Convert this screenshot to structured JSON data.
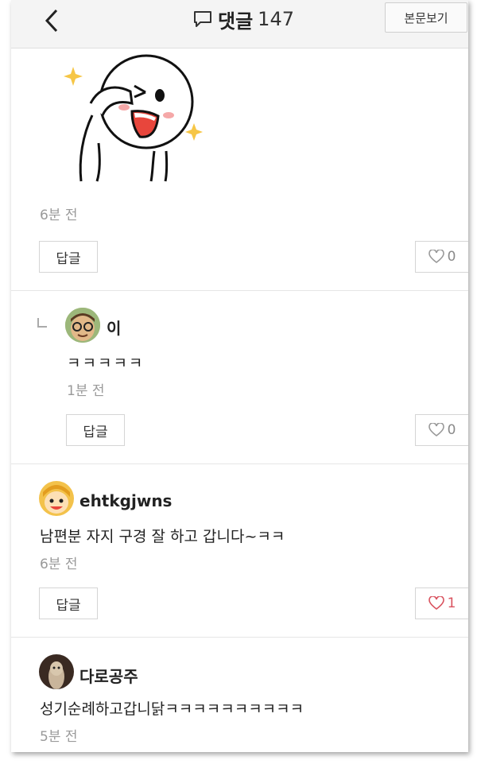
{
  "header": {
    "title": "댓글",
    "count": "147",
    "view_post_label": "본문보기"
  },
  "comments": [
    {
      "sticker": "sticker-character-wink",
      "time": "6분 전",
      "reply_label": "답글",
      "likes": "0",
      "liked": false
    },
    {
      "is_reply": true,
      "username": "이",
      "text": "ㅋㅋㅋㅋㅋ",
      "time": "1분 전",
      "reply_label": "답글",
      "likes": "0",
      "liked": false
    },
    {
      "username": "ehtkgjwns",
      "text": "남편분 자지 구경 잘 하고 갑니다~ㅋㅋ",
      "time": "6분 전",
      "reply_label": "답글",
      "likes": "1",
      "liked": true
    },
    {
      "username": "다로공주",
      "text": "성기순례하고갑니닭ㅋㅋㅋㅋㅋㅋㅋㅋㅋㅋ",
      "time": "5분 전"
    }
  ],
  "colors": {
    "header_bg": "#f4f4f4",
    "like_active": "#d9535f",
    "muted_text": "#9a9a9a"
  }
}
